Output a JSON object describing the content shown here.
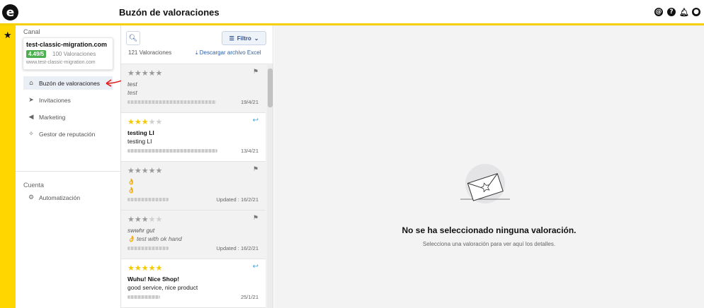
{
  "header": {
    "logo_glyph": "e",
    "title": "Buzón de valoraciones"
  },
  "rail": {
    "star_glyph": "★"
  },
  "sidebar": {
    "channel_section": "Canal",
    "channel": {
      "name": "test-classic-migration.com",
      "rating": "4.49/5",
      "reviews": "100 Valoraciones",
      "url": "www.test-classic-migration.com"
    },
    "items": [
      {
        "label": "Buzón de valoraciones",
        "icon": "inbox-icon",
        "glyph": "⌂",
        "active": true
      },
      {
        "label": "Invitaciones",
        "icon": "paper-plane-icon",
        "glyph": "➤",
        "active": false
      },
      {
        "label": "Marketing",
        "icon": "megaphone-icon",
        "glyph": "◀",
        "active": false
      },
      {
        "label": "Gestor de reputación",
        "icon": "sparkle-icon",
        "glyph": "✧",
        "active": false
      }
    ],
    "account_section": "Cuenta",
    "account_items": [
      {
        "label": "Automatización",
        "icon": "robot-icon",
        "glyph": "⚙"
      }
    ]
  },
  "list": {
    "filter_label": "Filtro",
    "total": "121 Valoraciones",
    "download": "Descargar archivo Excel",
    "reviews": [
      {
        "stars": 5,
        "filled": 5,
        "color": "grey",
        "title": "test",
        "body": "test",
        "title_style": "italic",
        "date": "19/4/21",
        "action": "flag",
        "bg": "grey"
      },
      {
        "stars": 5,
        "filled": 3,
        "color": "yellow",
        "title": "testing LI",
        "body": "testing LI",
        "title_style": "bold",
        "date": "13/4/21",
        "action": "reply",
        "bg": "white"
      },
      {
        "stars": 5,
        "filled": 5,
        "color": "grey",
        "title": "👌",
        "body": "👌",
        "title_style": "normal",
        "date": "Updated : 16/2/21",
        "action": "flag",
        "bg": "grey"
      },
      {
        "stars": 5,
        "filled": 3,
        "color": "grey",
        "title": "swwhr gut",
        "body": "👌 test with ok hand",
        "title_style": "italic",
        "date": "Updated : 16/2/21",
        "action": "flag",
        "bg": "grey"
      },
      {
        "stars": 5,
        "filled": 5,
        "color": "yellow",
        "title": "Wuhu! Nice Shop!",
        "body": "good service, nice product",
        "title_style": "bold",
        "date": "25/1/21",
        "action": "reply",
        "bg": "white"
      }
    ]
  },
  "detail": {
    "empty_title": "No se ha seleccionado ninguna valoración.",
    "empty_sub": "Selecciona una valoración para ver aquí los detalles."
  },
  "colors": {
    "accent": "#ffd600",
    "badge": "#4caf50",
    "link": "#2d5fa6",
    "star": "#f5c900"
  }
}
